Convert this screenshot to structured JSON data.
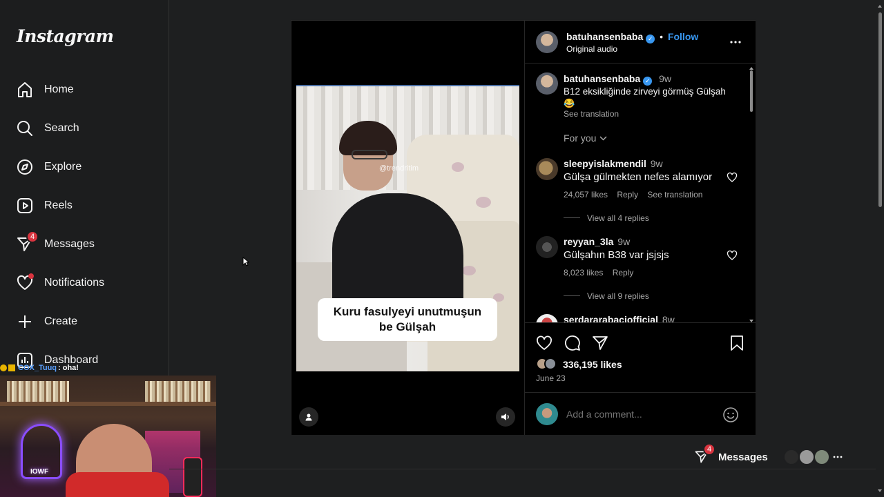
{
  "app": {
    "logo": "Instagram"
  },
  "sidebar": {
    "items": [
      {
        "label": "Home",
        "icon": "home-icon"
      },
      {
        "label": "Search",
        "icon": "search-icon"
      },
      {
        "label": "Explore",
        "icon": "compass-icon"
      },
      {
        "label": "Reels",
        "icon": "reels-icon"
      },
      {
        "label": "Messages",
        "icon": "messenger-icon",
        "badge": "4"
      },
      {
        "label": "Notifications",
        "icon": "heart-icon"
      },
      {
        "label": "Create",
        "icon": "plus-icon"
      },
      {
        "label": "Dashboard",
        "icon": "dashboard-icon"
      }
    ]
  },
  "stream_chat": {
    "user": "COX_Tuuq",
    "message": ": oha!"
  },
  "webcam": {
    "neon_text": "IOWF"
  },
  "post": {
    "author": "batuhansenbaba",
    "follow": "Follow",
    "separator": "•",
    "audio": "Original audio",
    "video": {
      "watermark": "@trendritim",
      "caption": "Kuru fasulyeyi unutmuşun\nbe Gülşah"
    },
    "description": {
      "author": "batuhansenbaba",
      "time": "9w",
      "text": "B12 eksikliğinde zirveyi görmüş Gülşah",
      "emoji": "😂",
      "see_translation": "See translation"
    },
    "sort": "For you",
    "comments": [
      {
        "user": "sleepyislakmendil",
        "time": "9w",
        "text": "Gülşa gülmekten nefes alamıyor",
        "likes": "24,057 likes",
        "reply": "Reply",
        "translate": "See translation",
        "view_replies": "View all 4 replies"
      },
      {
        "user": "reyyan_3la",
        "time": "9w",
        "text": "Gülşahın B38 var jsjsjs",
        "likes": "8,023 likes",
        "reply": "Reply",
        "view_replies": "View all 9 replies"
      },
      {
        "user": "serdararabaciofficial",
        "time": "8w"
      }
    ],
    "likes": "336,195 likes",
    "date": "June 23",
    "add_comment_placeholder": "Add a comment..."
  },
  "messages_bar": {
    "label": "Messages",
    "badge": "4"
  },
  "colors": {
    "accent": "#3897f0",
    "badge": "#d9343f",
    "bg": "#1e1f20"
  }
}
